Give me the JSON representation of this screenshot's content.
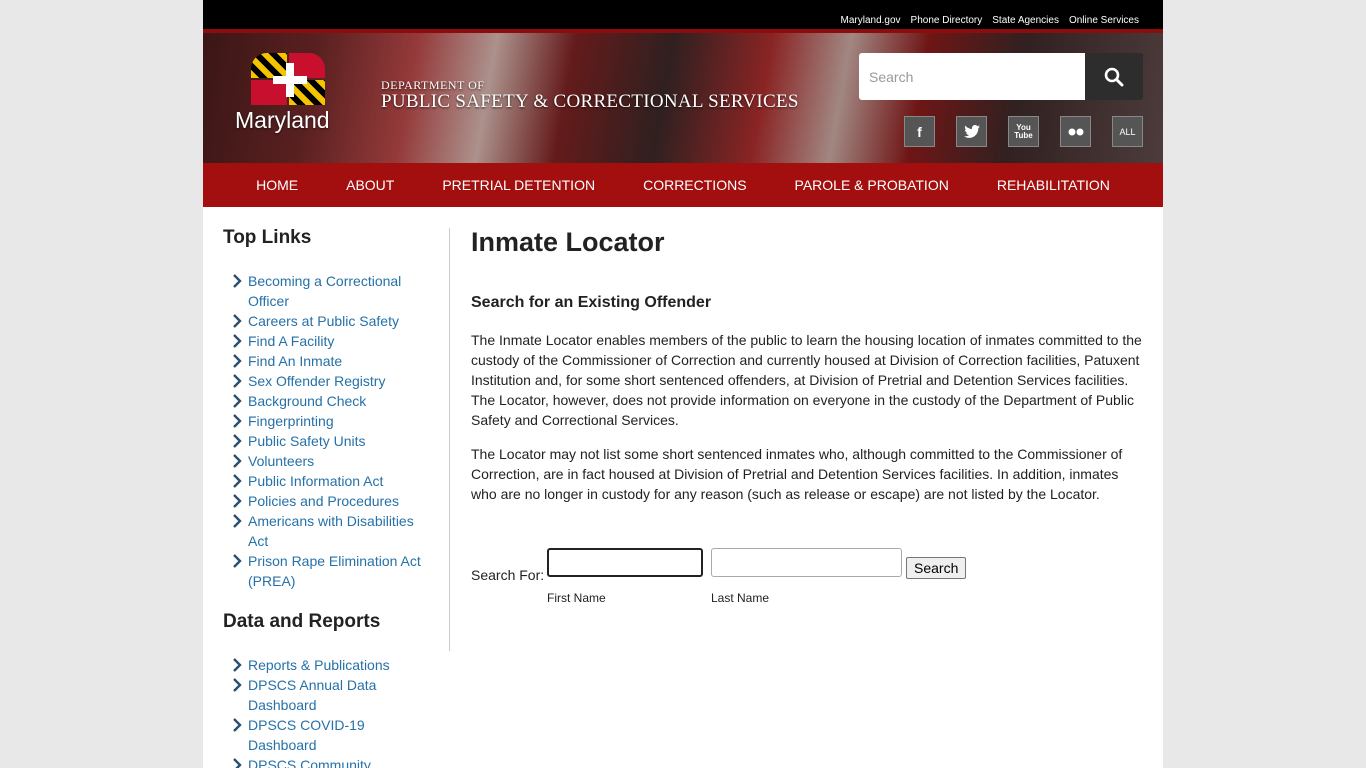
{
  "utility_links": [
    "Maryland.gov",
    "Phone Directory",
    "State Agencies",
    "Online Services"
  ],
  "header": {
    "logo_text": "Maryland",
    "dept_small": "DEPARTMENT OF",
    "dept_big": "PUBLIC SAFETY & CORRECTIONAL SERVICES",
    "search_placeholder": "Search",
    "social": [
      "f",
      "t",
      "You Tube",
      "flickr",
      "ALL"
    ]
  },
  "nav": [
    "HOME",
    "ABOUT",
    "PRETRIAL DETENTION",
    "CORRECTIONS",
    "PAROLE & PROBATION",
    "REHABILITATION"
  ],
  "sidebar": {
    "top_links_title": "Top Links",
    "top_links": [
      "Becoming a Correctional Officer",
      "Careers at Public Safety",
      "Find A Facility",
      "Find An Inmate",
      "Sex Offender Registry",
      "Background Check",
      "Fingerprinting",
      "Public Safety Units",
      "Volunteers",
      "Public Information Act",
      "Policies and Procedures",
      "Americans with Disabilities Act",
      "Prison Rape Elimination Act (PREA)"
    ],
    "data_reports_title": "Data and Reports",
    "data_reports": [
      "Reports & Publications",
      "DPSCS Annual Data Dashboard",
      "DPSCS COVID-19 Dashboard",
      "DPSCS Community"
    ]
  },
  "main": {
    "title": "Inmate Locator",
    "subtitle": "Search for an Existing Offender",
    "para1": "The Inmate Locator enables members of the public to learn the housing location of inmates committed to the custody of the Commissioner of Correction and currently housed at Division of Correction facilities, Patuxent Institution and, for some short sentenced offenders, at Division of Pretrial and Detention Services facilities. The Locator, however, does not provide information on everyone in the custody of the Department of Public Safety and Correctional Services.",
    "para2": "The Locator may not list some short sentenced inmates who, although committed to the Commissioner of Correction, are in fact housed at Division of Pretrial and Detention Services facilities. In addition, inmates who are no longer in custody for any reason (such as release or escape) are not listed by the Locator.",
    "form": {
      "label": "Search For:",
      "first_name_value": "",
      "last_name_value": "",
      "button": "Search",
      "first_name_caption": "First Name",
      "last_name_caption": "Last Name"
    }
  },
  "colors": {
    "nav_bg": "#a30f0f",
    "link": "#2571a8",
    "accent_border": "#8d0c0c"
  }
}
